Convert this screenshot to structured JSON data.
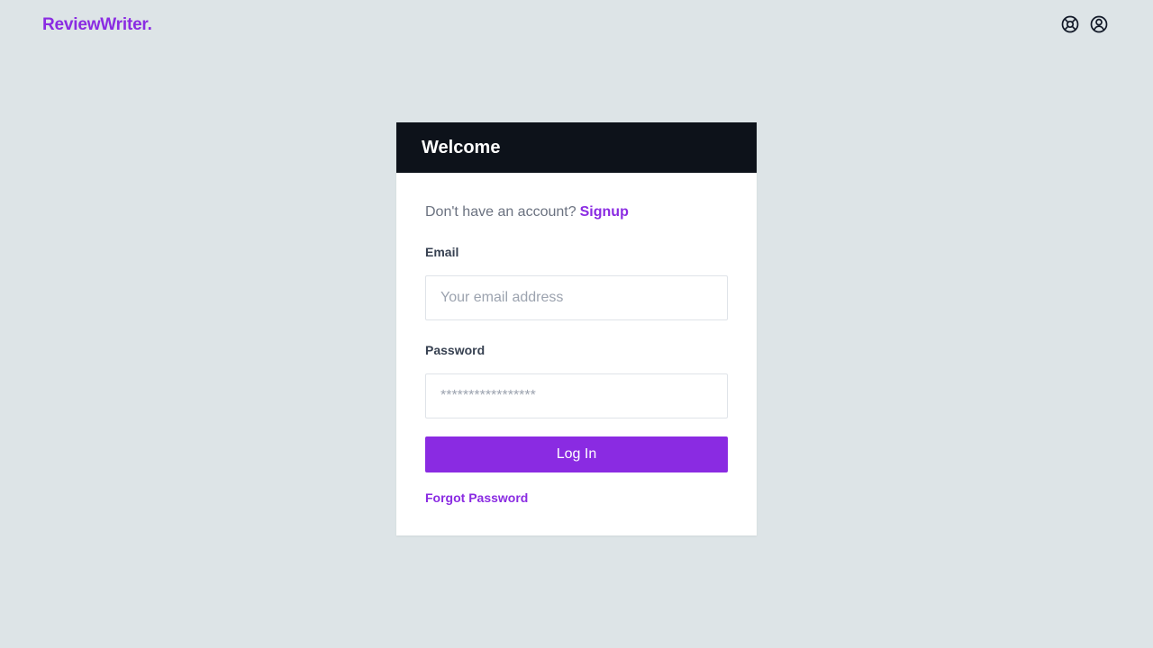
{
  "brand": {
    "name": "ReviewWriter.",
    "color": "#8a2be2"
  },
  "topbar": {
    "icons": [
      "help-icon",
      "user-icon"
    ]
  },
  "card": {
    "title": "Welcome",
    "signup": {
      "prompt": "Don't have an account?",
      "link": "Signup"
    },
    "email": {
      "label": "Email",
      "placeholder": "Your email address",
      "value": ""
    },
    "password": {
      "label": "Password",
      "placeholder": "*****************",
      "value": ""
    },
    "login_button": "Log In",
    "forgot_password": "Forgot Password"
  },
  "colors": {
    "background": "#dde4e7",
    "header": "#0d121a",
    "accent": "#8a2be2"
  }
}
